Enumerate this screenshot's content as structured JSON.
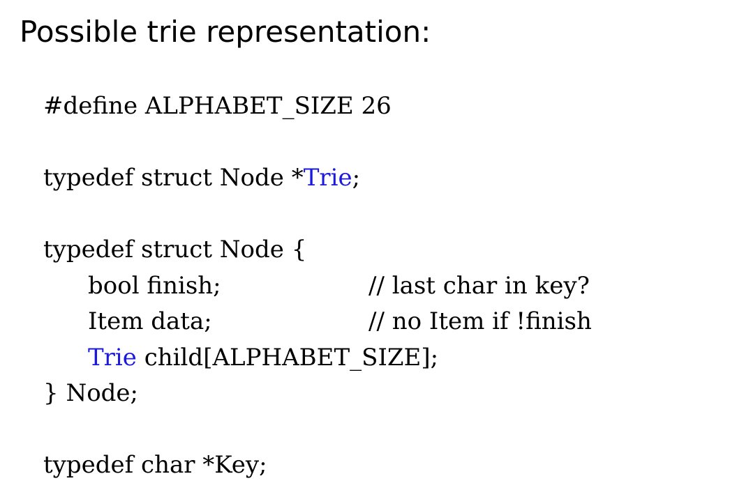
{
  "title": "Possible trie representation:",
  "code": {
    "define_line": "#define ALPHABET_SIZE 26",
    "trie_typedef": {
      "prefix": "typedef struct Node *",
      "type": "Trie",
      "suffix": ";"
    },
    "struct_open": "typedef struct Node {",
    "field_finish": {
      "decl": "bool finish;",
      "comment": "// last char in key?"
    },
    "field_data": {
      "decl": "Item data;",
      "comment": "// no Item if !finish"
    },
    "field_child": {
      "type": "Trie",
      "decl": " child[ALPHABET_SIZE];"
    },
    "struct_close": "} Node;",
    "key_typedef": "typedef char *Key;"
  },
  "colors": {
    "text": "#000000",
    "type_highlight": "#1a1adc",
    "background": "#ffffff"
  }
}
